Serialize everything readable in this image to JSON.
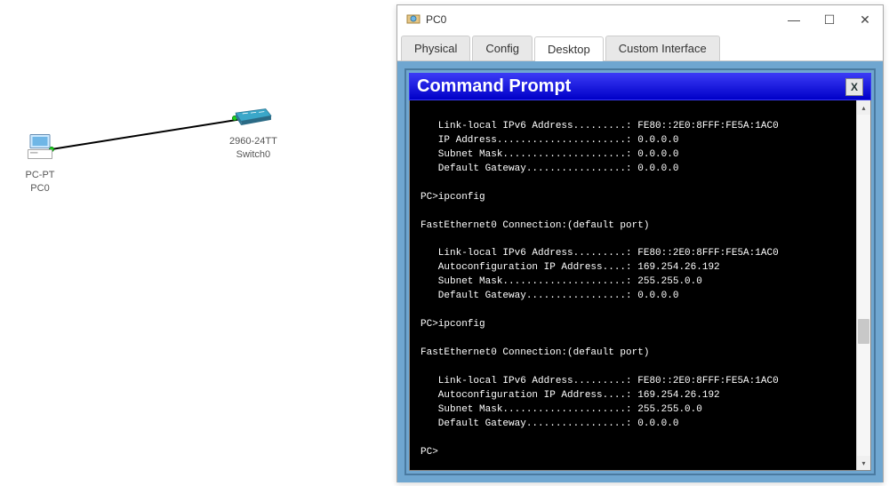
{
  "topology": {
    "pc": {
      "line1": "PC-PT",
      "line2": "PC0"
    },
    "switch": {
      "line1": "2960-24TT",
      "line2": "Switch0"
    }
  },
  "window": {
    "title": "PC0",
    "buttons": {
      "min": "—",
      "max": "☐",
      "close": "✕"
    },
    "tabs": [
      {
        "label": "Physical",
        "active": false
      },
      {
        "label": "Config",
        "active": false
      },
      {
        "label": "Desktop",
        "active": true
      },
      {
        "label": "Custom Interface",
        "active": false
      }
    ]
  },
  "cmd": {
    "title": "Command Prompt",
    "close": "X"
  },
  "terminal_lines": [
    "",
    "   Link-local IPv6 Address.........: FE80::2E0:8FFF:FE5A:1AC0",
    "   IP Address......................: 0.0.0.0",
    "   Subnet Mask.....................: 0.0.0.0",
    "   Default Gateway.................: 0.0.0.0",
    "",
    "PC>ipconfig",
    "",
    "FastEthernet0 Connection:(default port)",
    "",
    "   Link-local IPv6 Address.........: FE80::2E0:8FFF:FE5A:1AC0",
    "   Autoconfiguration IP Address....: 169.254.26.192",
    "   Subnet Mask.....................: 255.255.0.0",
    "   Default Gateway.................: 0.0.0.0",
    "",
    "PC>ipconfig",
    "",
    "FastEthernet0 Connection:(default port)",
    "",
    "   Link-local IPv6 Address.........: FE80::2E0:8FFF:FE5A:1AC0",
    "   Autoconfiguration IP Address....: 169.254.26.192",
    "   Subnet Mask.....................: 255.255.0.0",
    "   Default Gateway.................: 0.0.0.0",
    "",
    "PC>"
  ]
}
